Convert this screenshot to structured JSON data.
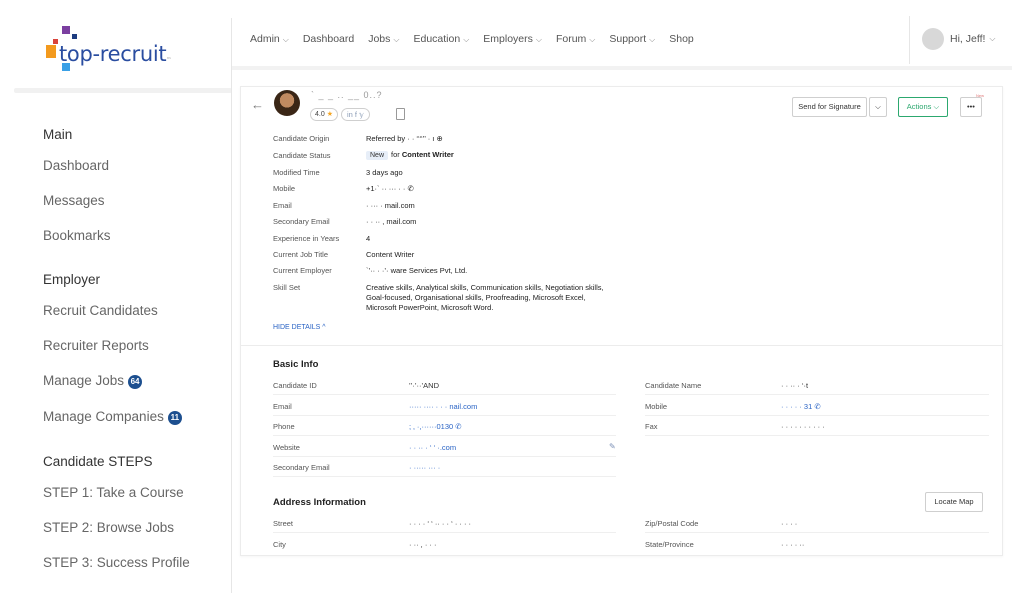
{
  "brand": {
    "name": "top-recruit",
    "tm": "™",
    "colors": {
      "purple": "#7b3fa0",
      "orange": "#f39a1e",
      "blue": "#2a7de1",
      "navy": "#1d3c80",
      "red": "#d9433a",
      "lightblue": "#3aa0e6"
    }
  },
  "sidebar": {
    "sections": [
      {
        "title": "Main",
        "items": [
          {
            "label": "Dashboard"
          },
          {
            "label": "Messages"
          },
          {
            "label": "Bookmarks"
          }
        ]
      },
      {
        "title": "Employer",
        "items": [
          {
            "label": "Recruit Candidates"
          },
          {
            "label": "Recruiter Reports"
          },
          {
            "label": "Manage Jobs",
            "badge": "64"
          },
          {
            "label": "Manage Companies",
            "badge": "11"
          }
        ]
      },
      {
        "title": "Candidate STEPS",
        "items": [
          {
            "label": "STEP 1: Take a Course"
          },
          {
            "label": "STEP 2: Browse Jobs"
          },
          {
            "label": "STEP 3: Success Profile"
          }
        ]
      }
    ]
  },
  "topnav": {
    "items": [
      {
        "label": "Admin",
        "dropdown": true
      },
      {
        "label": "Dashboard",
        "dropdown": false
      },
      {
        "label": "Jobs",
        "dropdown": true
      },
      {
        "label": "Education",
        "dropdown": true
      },
      {
        "label": "Employers",
        "dropdown": true
      },
      {
        "label": "Forum",
        "dropdown": true
      },
      {
        "label": "Support",
        "dropdown": true
      },
      {
        "label": "Shop",
        "dropdown": false
      }
    ],
    "chevron": "⌵",
    "user_greeting": "Hi, Jeff!"
  },
  "candidate": {
    "name": "` _  _ ..  __ 0..?",
    "rating": "4.0",
    "socials": "in  f  𝕪",
    "buttons": {
      "send_signature": "Send for Signature",
      "actions": "Actions",
      "more": "•••",
      "new_tag": "New"
    },
    "details": [
      {
        "label": "Candidate Origin",
        "value": "Referred  by   ·  ·  ‘‘‘‘’’  ·  ı  ⊕"
      },
      {
        "label": "Candidate Status",
        "status_pill": "New",
        "for_text": "for",
        "value": "Content Writer"
      },
      {
        "label": "Modified Time",
        "value": "3 days ago"
      },
      {
        "label": "Mobile",
        "value": "+1·` ·· ··· · ·  ✆"
      },
      {
        "label": "Email",
        "value": "·  ···  ·        mail.com"
      },
      {
        "label": "Secondary Email",
        "value": "· · ·· , mail.com"
      },
      {
        "label": "Experience in Years",
        "value": "4"
      },
      {
        "label": "Current Job Title",
        "value": "Content Writer"
      },
      {
        "label": "Current Employer",
        "value": "`‛·· ·  ·’·  ware Services Pvt, Ltd."
      },
      {
        "label": "Skill Set",
        "value": "Creative skills, Analytical skills, Communication skills, Negotiation skills, Goal-focused, Organisational skills, Proofreading, Microsoft Excel, Microsoft PowerPoint, Microsoft Word."
      }
    ],
    "hide_details": "HIDE DETAILS  ^"
  },
  "basic_info": {
    "title": "Basic Info",
    "left": [
      {
        "label": "Candidate ID",
        "value": "‛‛·‛··‛AND"
      },
      {
        "label": "Email",
        "value": "·····   ····  ·  · ·  nail.com",
        "link": true
      },
      {
        "label": "Phone",
        "value": "; ‚ ·,······0130   ✆",
        "link": true
      },
      {
        "label": "Website",
        "value": "·  ·  ··  ·  ‘ ‘ ·.com",
        "link": true
      },
      {
        "label": "Secondary Email",
        "value": "·  ·····  ···  ·"
      }
    ],
    "right": [
      {
        "label": "Candidate Name",
        "value": "·  · ··  ·  ‘·t"
      },
      {
        "label": "Mobile",
        "value": "·  ·  ·  ·  ·   31   ✆",
        "link": true
      },
      {
        "label": "Fax",
        "value": "· · · · · · · · · ·"
      }
    ]
  },
  "address": {
    "title": "Address Information",
    "locate_button": "Locate Map",
    "left": [
      {
        "label": "Street",
        "value": "·  ·  ·  ·  ‘ ‘  ··  ·  ·  ‘ · · ·  ·"
      },
      {
        "label": "City",
        "value": "·   ··  ,  ·  ·  ·"
      }
    ],
    "right": [
      {
        "label": "Zip/Postal Code",
        "value": "· ·  · ·"
      },
      {
        "label": "State/Province",
        "value": "·  ·  ·  ·  ··"
      }
    ]
  }
}
